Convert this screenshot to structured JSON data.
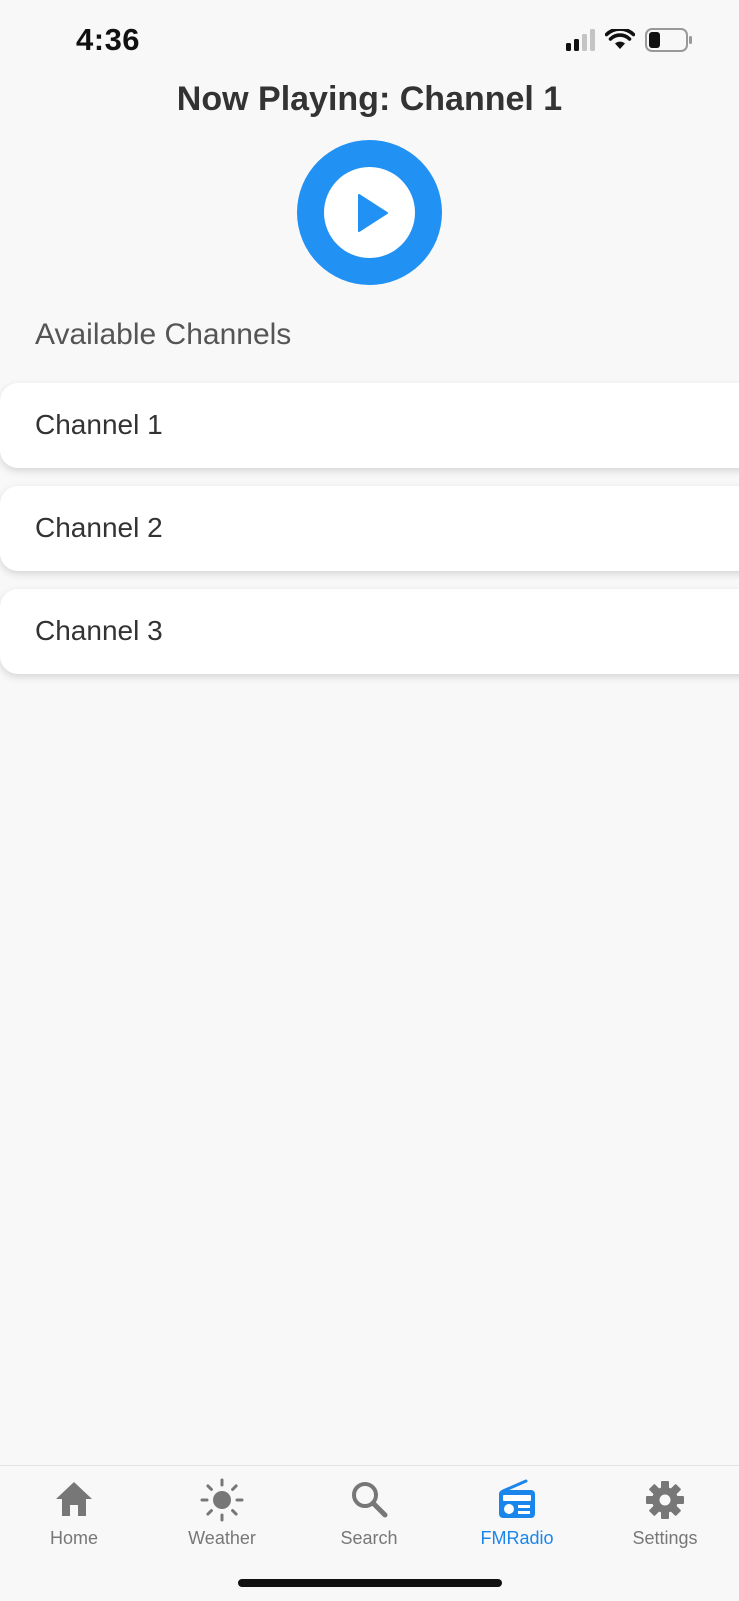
{
  "status_bar": {
    "time": "4:36"
  },
  "header": {
    "now_playing": "Now Playing: Channel 1"
  },
  "player": {
    "play_button_icon": "play-icon",
    "accent_color": "#2191f3"
  },
  "channels": {
    "title": "Available Channels",
    "items": [
      {
        "label": "Channel 1"
      },
      {
        "label": "Channel 2"
      },
      {
        "label": "Channel 3"
      }
    ]
  },
  "tab_bar": {
    "active_color": "#1a86ec",
    "inactive_color": "#777777",
    "tabs": [
      {
        "label": "Home",
        "icon": "home-icon",
        "active": false
      },
      {
        "label": "Weather",
        "icon": "sun-icon",
        "active": false
      },
      {
        "label": "Search",
        "icon": "search-icon",
        "active": false
      },
      {
        "label": "FMRadio",
        "icon": "radio-icon",
        "active": true
      },
      {
        "label": "Settings",
        "icon": "gear-icon",
        "active": false
      }
    ]
  }
}
